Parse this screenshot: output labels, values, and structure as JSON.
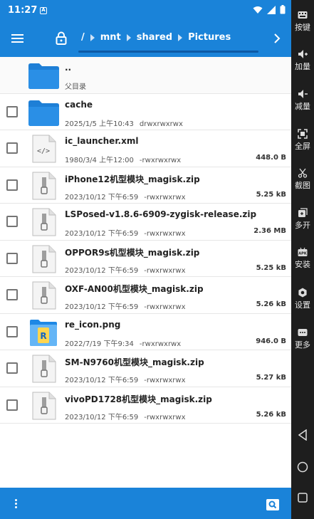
{
  "status_bar": {
    "time": "11:27",
    "notif_letter": "A"
  },
  "toolbar": {
    "crumbs": [
      "/",
      "mnt",
      "shared",
      "Pictures"
    ]
  },
  "files": [
    {
      "name": "..",
      "date": "父目录",
      "perm": "",
      "size": "",
      "kind": "folder",
      "parent": true
    },
    {
      "name": "cache",
      "date": "2025/1/5 上午10:43",
      "perm": "drwxrwxrwx",
      "size": "",
      "kind": "folder"
    },
    {
      "name": "ic_launcher.xml",
      "date": "1980/3/4 上午12:00",
      "perm": "-rwxrwxrwx",
      "size": "448.0 B",
      "kind": "xml"
    },
    {
      "name": "iPhone12机型模块_magisk.zip",
      "date": "2023/10/12 下午6:59",
      "perm": "-rwxrwxrwx",
      "size": "5.25 kB",
      "kind": "zip"
    },
    {
      "name": "LSPosed-v1.8.6-6909-zygisk-release.zip",
      "date": "2023/10/12 下午6:59",
      "perm": "-rwxrwxrwx",
      "size": "2.36 MB",
      "kind": "zip"
    },
    {
      "name": "OPPOR9s机型模块_magisk.zip",
      "date": "2023/10/12 下午6:59",
      "perm": "-rwxrwxrwx",
      "size": "5.25 kB",
      "kind": "zip"
    },
    {
      "name": "OXF-AN00机型模块_magisk.zip",
      "date": "2023/10/12 下午6:59",
      "perm": "-rwxrwxrwx",
      "size": "5.26 kB",
      "kind": "zip"
    },
    {
      "name": "re_icon.png",
      "date": "2022/7/19 下午9:34",
      "perm": "-rwxrwxrwx",
      "size": "946.0 B",
      "kind": "png"
    },
    {
      "name": "SM-N9760机型模块_magisk.zip",
      "date": "2023/10/12 下午6:59",
      "perm": "-rwxrwxrwx",
      "size": "5.27 kB",
      "kind": "zip"
    },
    {
      "name": "vivoPD1728机型模块_magisk.zip",
      "date": "2023/10/12 下午6:59",
      "perm": "-rwxrwxrwx",
      "size": "5.26 kB",
      "kind": "zip"
    }
  ],
  "side_panel": [
    {
      "label": "按键",
      "icon": "keyboard-icon"
    },
    {
      "label": "加量",
      "icon": "volume-up-icon"
    },
    {
      "label": "减量",
      "icon": "volume-down-icon"
    },
    {
      "label": "全屏",
      "icon": "fullscreen-icon"
    },
    {
      "label": "截图",
      "icon": "scissors-icon"
    },
    {
      "label": "多开",
      "icon": "multi-open-icon"
    },
    {
      "label": "安装",
      "icon": "apk-install-icon"
    },
    {
      "label": "设置",
      "icon": "settings-icon"
    },
    {
      "label": "更多",
      "icon": "more-icon"
    }
  ],
  "colors": {
    "primary": "#1a83d9",
    "folder": "#1e7fd6",
    "side": "#1e1e1e"
  }
}
